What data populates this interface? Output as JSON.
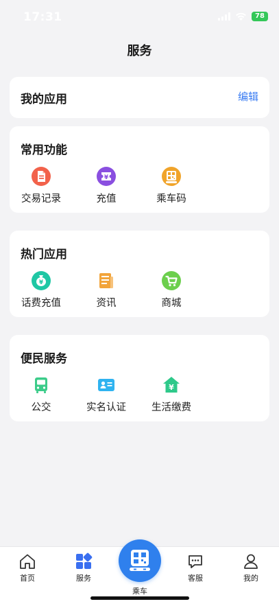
{
  "status_bar": {
    "time": "17:31",
    "battery": "78"
  },
  "header": {
    "title": "服务"
  },
  "my_apps": {
    "title": "我的应用",
    "edit_label": "编辑"
  },
  "common_functions": {
    "title": "常用功能",
    "items": [
      {
        "label": "交易记录",
        "icon": "document-icon",
        "color": "#f2624b"
      },
      {
        "label": "充值",
        "icon": "ticket-icon",
        "color": "#8a4fe0"
      },
      {
        "label": "乘车码",
        "icon": "qr-code-icon",
        "color": "#f0a42b"
      }
    ]
  },
  "hot_apps": {
    "title": "热门应用",
    "items": [
      {
        "label": "话费充值",
        "icon": "money-bag-icon",
        "color": "#1fc7a4"
      },
      {
        "label": "资讯",
        "icon": "newspaper-icon",
        "color": "#f2a43a"
      },
      {
        "label": "商城",
        "icon": "shopping-cart-icon",
        "color": "#6ccf4d"
      }
    ]
  },
  "convenience": {
    "title": "便民服务",
    "items": [
      {
        "label": "公交",
        "icon": "bus-icon",
        "color": "#3ccc8a"
      },
      {
        "label": "实名认证",
        "icon": "id-card-icon",
        "color": "#2fb3f0"
      },
      {
        "label": "生活缴费",
        "icon": "house-payment-icon",
        "color": "#2ec98a"
      }
    ]
  },
  "tabbar": {
    "items": [
      {
        "label": "首页",
        "icon": "home-icon"
      },
      {
        "label": "服务",
        "icon": "grid-icon",
        "color": "#3a6ff0"
      },
      {
        "label": "乘车",
        "icon": "qr-code-icon",
        "color": "#2f80ed"
      },
      {
        "label": "客服",
        "icon": "chat-icon"
      },
      {
        "label": "我的",
        "icon": "user-icon"
      }
    ]
  }
}
